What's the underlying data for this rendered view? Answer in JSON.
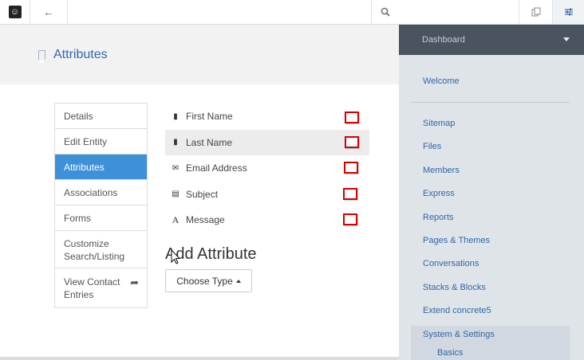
{
  "toolbar": {
    "logo_icon": "concrete5-logo-icon",
    "back_icon": "arrow-left-icon",
    "search_icon": "search-icon",
    "copy_icon": "copy-icon",
    "settings_icon": "sliders-icon"
  },
  "page": {
    "title": "Attributes"
  },
  "entity_nav": {
    "items": [
      {
        "label": "Details",
        "active": false
      },
      {
        "label": "Edit Entity",
        "active": false
      },
      {
        "label": "Attributes",
        "active": true
      },
      {
        "label": "Associations",
        "active": false
      },
      {
        "label": "Forms",
        "active": false
      },
      {
        "label": "Customize Search/Listing",
        "active": false
      },
      {
        "label": "View Contact Entries",
        "active": false,
        "icon": "share-arrow-icon"
      }
    ]
  },
  "attributes": {
    "items": [
      {
        "label": "First Name",
        "icon": "file-icon"
      },
      {
        "label": "Last Name",
        "icon": "file-icon"
      },
      {
        "label": "Email Address",
        "icon": "envelope-icon"
      },
      {
        "label": "Subject",
        "icon": "list-icon"
      },
      {
        "label": "Message",
        "icon": "font-icon"
      }
    ],
    "highlight_color": "#d40000"
  },
  "add_attribute": {
    "heading": "Add Attribute",
    "button_label": "Choose Type"
  },
  "dashboard": {
    "header": "Dashboard",
    "welcome": "Welcome",
    "items": [
      "Sitemap",
      "Files",
      "Members",
      "Express",
      "Reports",
      "Pages & Themes",
      "Conversations",
      "Stacks & Blocks",
      "Extend concrete5",
      "System & Settings"
    ],
    "sub_items": [
      "Basics"
    ]
  },
  "colors": {
    "accent": "#3e90d8",
    "link": "#2f67a8",
    "panel_bg": "#dfe4e9",
    "panel_header": "#4a5460"
  }
}
